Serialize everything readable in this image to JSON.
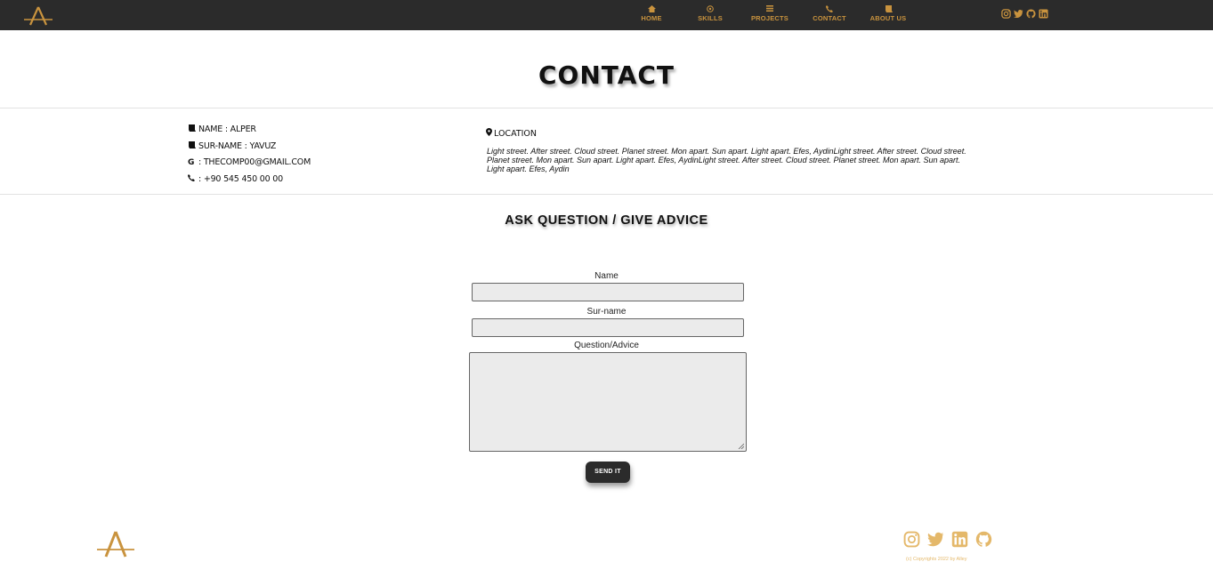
{
  "header": {
    "nav": [
      {
        "label": "HOME",
        "icon": "home-icon"
      },
      {
        "label": "SKILLS",
        "icon": "target-icon"
      },
      {
        "label": "PROJECTS",
        "icon": "list-icon"
      },
      {
        "label": "CONTACT",
        "icon": "phone-icon"
      },
      {
        "label": "ABOUT US",
        "icon": "scroll-icon"
      }
    ],
    "social": [
      "instagram-icon",
      "twitter-icon",
      "github-icon",
      "linkedin-icon"
    ]
  },
  "page": {
    "title": "CONTACT"
  },
  "info": {
    "name": "NAME : ALPER",
    "surname": "SUR-NAME : YAVUZ",
    "email": ": THECOMP00@GMAIL.COM",
    "phone": ": +90 545 450 00 00",
    "location_label": "LOCATION",
    "location_text": "Light street. After street. Cloud street. Planet street. Mon apart. Sun apart. Light apart. Efes, AydinLight street. After street. Cloud street. Planet street. Mon apart. Sun apart. Light apart. Efes, AydinLight street. After street. Cloud street. Planet street. Mon apart. Sun apart. Light apart. Efes, Aydin"
  },
  "form": {
    "title": "ASK QUESTION / GIVE ADVICE",
    "name_label": "Name",
    "name_value": "",
    "surname_label": "Sur-name",
    "surname_value": "",
    "question_label": "Question/Advice",
    "question_value": "",
    "submit_label": "SEND IT"
  },
  "footer": {
    "social": [
      "instagram-icon",
      "twitter-icon",
      "linkedin-icon",
      "github-icon"
    ],
    "copyright": "(c) Copyrights 2022 by Alley"
  },
  "colors": {
    "accent": "#c9933e",
    "footer_accent": "#e4b86a",
    "bar": "#2b2b2b"
  }
}
